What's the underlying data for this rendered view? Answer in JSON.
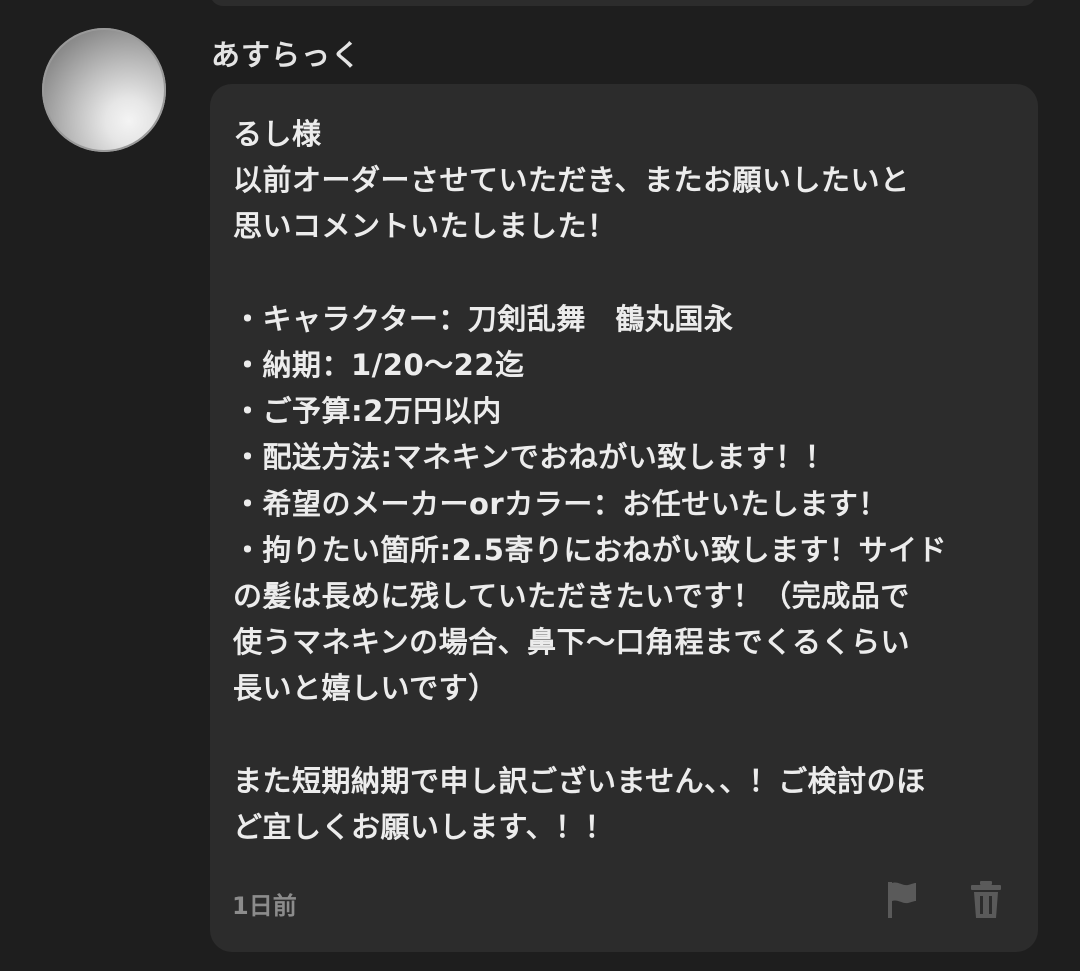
{
  "comment": {
    "author": "あすらっく",
    "message": "るし様\n以前オーダーさせていただき、またお願いしたいと\n思いコメントいたしました！\n\n・キャラクター：刀剣乱舞　鶴丸国永\n・納期：1/20〜22迄\n・ご予算:2万円以内\n・配送方法:マネキンでおねがい致します！！\n・希望のメーカーorカラー：お任せいたします！\n・拘りたい箇所:2.5寄りにおねがい致します！サイド\nの髪は長めに残していただきたいです！（完成品で\n使うマネキンの場合、鼻下〜口角程までくるくらい\n長いと嬉しいです）\n\nまた短期納期で申し訳ございません、、！ご検討のほ\nど宜しくお願いします、！！",
    "timestamp": "1日前"
  },
  "actions": {
    "report_icon": "flag-icon",
    "delete_icon": "trash-icon"
  },
  "colors": {
    "background": "#1e1e1e",
    "bubble": "#2c2c2c",
    "text": "#ececec",
    "muted": "#8c8c8c",
    "icon": "#5a5a5a"
  }
}
